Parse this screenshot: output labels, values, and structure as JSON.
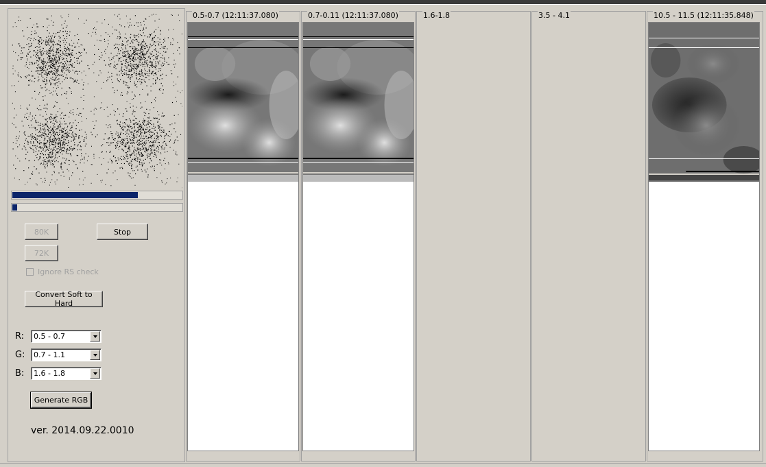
{
  "window": {
    "version": "ver. 2014.09.22.0010"
  },
  "progress": {
    "primary_fraction": 0.74,
    "secondary_fraction": 0.03
  },
  "buttons": {
    "mode_80k": "80K",
    "mode_72k": "72K",
    "stop": "Stop",
    "convert": "Convert Soft to Hard",
    "generate_rgb": "Generate RGB"
  },
  "checkbox": {
    "ignore_rs": "Ignore RS check",
    "checked": false
  },
  "rgb": {
    "r_label": "R:",
    "g_label": "G:",
    "b_label": "B:",
    "r_value": "0.5 - 0.7",
    "g_value": "0.7 - 1.1",
    "b_value": "1.6 - 1.8"
  },
  "channels": [
    {
      "title": "0.5-0.7 (12:11:37.080)",
      "has_image": true
    },
    {
      "title": "0.7-0.11 (12:11:37.080)",
      "has_image": true
    },
    {
      "title": "1.6-1.8",
      "has_image": false
    },
    {
      "title": "3.5 - 4.1",
      "has_image": false
    },
    {
      "title": "10.5 - 11.5 (12:11:35.848)",
      "has_image": true
    }
  ]
}
